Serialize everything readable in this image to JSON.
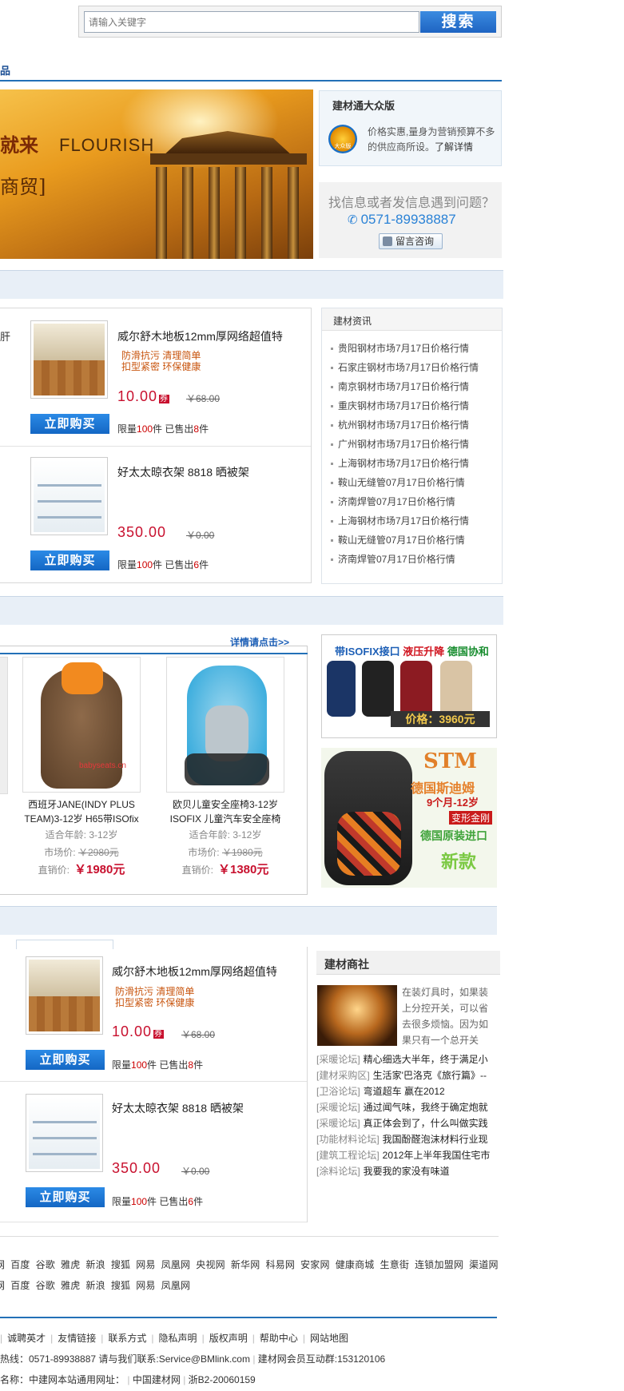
{
  "search": {
    "placeholder": "请输入关键字",
    "button": "搜索"
  },
  "nav": {
    "tail_label": "品"
  },
  "banner": {
    "headline": "就来",
    "english": "FLOURISH",
    "subtext": "商贸]"
  },
  "promo": {
    "title": "建材通大众版",
    "badge": "大众版",
    "desc": "价格实惠,量身为营销预算不多的供应商所设。",
    "more_link": "了解详情"
  },
  "help": {
    "question": "找信息或者发信息遇到问题？",
    "phone": "0571-89938887",
    "button": "留言咨询"
  },
  "section1": {
    "left_edge": "肝",
    "products": [
      {
        "title": "威尔舒木地板12mm厚网络超值特",
        "tagline1": "防滑抗污  清理简单",
        "tagline2": "扣型紧密  环保健康",
        "price": "10.00",
        "old_price": "￥68.00",
        "buy": "立即购买",
        "limit_pre": "限量",
        "limit": "100",
        "limit_unit": "件  已售出",
        "sold": "8",
        "sold_unit": "件"
      },
      {
        "title": "好太太晾衣架  8818  晒被架",
        "tagline1": "",
        "tagline2": "",
        "price": "350.00",
        "old_price": "￥0.00",
        "buy": "立即购买",
        "limit_pre": "限量",
        "limit": "100",
        "limit_unit": "件  已售出",
        "sold": "6",
        "sold_unit": "件"
      }
    ],
    "news_title": "建材资讯",
    "news": [
      "贵阳钢材市场7月17日价格行情",
      "石家庄钢材市场7月17日价格行情",
      "南京钢材市场7月17日价格行情",
      "重庆钢材市场7月17日价格行情",
      "杭州钢材市场7月17日价格行情",
      "广州钢材市场7月17日价格行情",
      "上海钢材市场7月17日价格行情",
      "鞍山无缝管07月17日价格行情",
      "济南焊管07月17日价格行情",
      "上海钢材市场7月17日价格行情",
      "鞍山无缝管07月17日价格行情",
      "济南焊管07月17日价格行情"
    ]
  },
  "section2": {
    "more": "详情请点击>>",
    "seats": [
      {
        "name1": "西班牙JANE(INDY PLUS",
        "name2": "TEAM)3-12岁 H65带ISOfix",
        "age_label": "适合年龄:",
        "age": "3-12岁",
        "market_label": "市场价:",
        "market": "￥2980元",
        "direct_label": "直销价:",
        "direct": "￥1980元",
        "watermark": "babyseats.cn"
      },
      {
        "name1": "欧贝儿童安全座椅3-12岁",
        "name2": "ISOFIX 儿童汽车安全座椅",
        "age_label": "适合年龄:",
        "age": "3-12岁",
        "market_label": "市场价:",
        "market": "￥1980元",
        "direct_label": "直销价:",
        "direct": "￥1380元",
        "watermark": ""
      }
    ],
    "ad1": {
      "t1": "带ISOFIX接口",
      "t2": "液压升降",
      "t3": "德国协和",
      "price": "价格：3960元"
    },
    "ad2": {
      "brand": "STM",
      "l1": "德国斯迪姆",
      "l2": "9个月-12岁",
      "l3": "变形金刚",
      "l4": "德国原装进口",
      "l5": "新款"
    }
  },
  "section3": {
    "products": [
      {
        "title": "威尔舒木地板12mm厚网络超值特",
        "tagline1": "防滑抗污  清理简单",
        "tagline2": "扣型紧密  环保健康",
        "price": "10.00",
        "old_price": "￥68.00",
        "buy": "立即购买",
        "limit_pre": "限量",
        "limit": "100",
        "limit_unit": "件  已售出",
        "sold": "8",
        "sold_unit": "件"
      },
      {
        "title": "好太太晾衣架  8818  晒被架",
        "tagline1": "",
        "tagline2": "",
        "price": "350.00",
        "old_price": "￥0.00",
        "buy": "立即购买",
        "limit_pre": "限量",
        "limit": "100",
        "limit_unit": "件  已售出",
        "sold": "6",
        "sold_unit": "件"
      }
    ],
    "community_title": "建材商社",
    "intro": [
      "在装灯具时，如果装",
      "上分控开关，可以省",
      "去很多烦恼。因为如",
      "果只有一个总开关"
    ],
    "forum": [
      {
        "tag": "[采暖论坛]",
        "text": "精心细选大半年，终于满足小"
      },
      {
        "tag": "[建材采购区]",
        "text": "生活家'巴洛克《旅行篇》--"
      },
      {
        "tag": "[卫浴论坛]",
        "text": "弯道超车 赢在2012"
      },
      {
        "tag": "[采暖论坛]",
        "text": "通过闻气味，我终于确定炮就"
      },
      {
        "tag": "[采暖论坛]",
        "text": "真正体会到了，什么叫做实践"
      },
      {
        "tag": "[功能材料论坛]",
        "text": "我国酚醛泡沫材料行业现"
      },
      {
        "tag": "[建筑工程论坛]",
        "text": "2012年上半年我国住宅市"
      },
      {
        "tag": "[涂料论坛]",
        "text": "我要我的家没有味道"
      }
    ]
  },
  "links": {
    "row1": [
      "网",
      "百度",
      "谷歌",
      "雅虎",
      "新浪",
      "搜狐",
      "网易",
      "凤凰网",
      "央视网",
      "新华网",
      "科易网",
      "安家网",
      "健康商城",
      "生意街",
      "连锁加盟网",
      "渠道网"
    ],
    "row2": [
      "网",
      "百度",
      "谷歌",
      "雅虎",
      "新浪",
      "搜狐",
      "网易",
      "凤凰网"
    ]
  },
  "footer": {
    "nav": [
      "诚聘英才",
      "友情链接",
      "联系方式",
      "隐私声明",
      "版权声明",
      "帮助中心",
      "网站地图"
    ],
    "hotline": "热线：0571-89938887 请与我们联系:Service@BMlink.com",
    "member": "建材网会员互动群:153120106",
    "name": "名称：中建网本站通用网址：",
    "site": "中国建材网",
    "icp": "浙B2-20060159"
  }
}
